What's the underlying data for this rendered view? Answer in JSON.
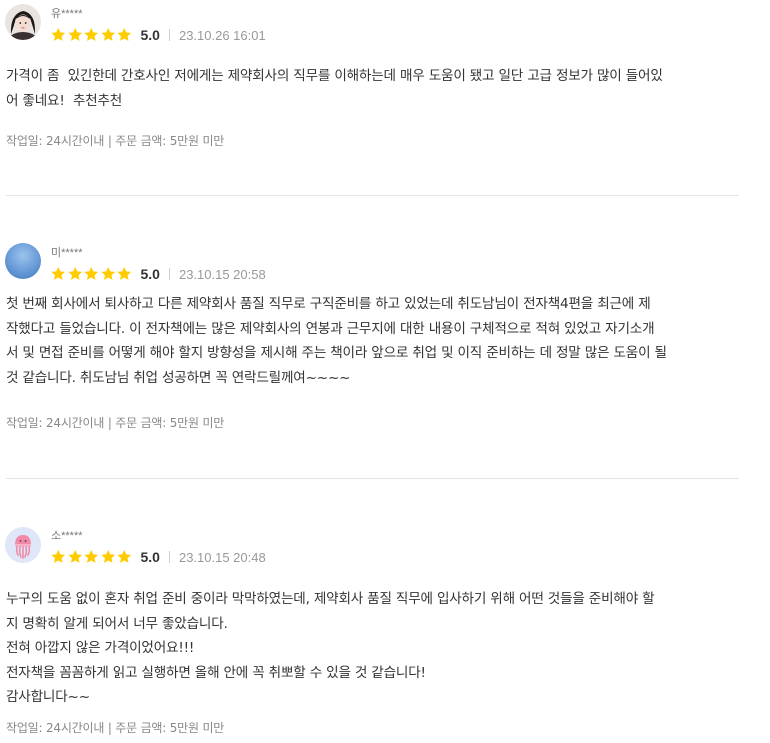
{
  "colors": {
    "star": "#ffcc00",
    "divider": "#e4e4e4",
    "meta_text": "#888888"
  },
  "reviews": [
    {
      "avatar_icon": "user-photo-avatar",
      "user": "유*****",
      "stars": 5,
      "score": "5.0",
      "date": "23.10.26 16:01",
      "body": "가격이 좀  있긴한데 간호사인 저에게는 제약회사의 직무를 이해하는데 매우 도움이 됐고 일단 고급 정보가 많이 들어있\n어 좋네요!  추천추천",
      "meta": "작업일: 24시간이내 | 주문 금액: 5만원 미만"
    },
    {
      "avatar_icon": "blue-gradient-avatar",
      "user": "미*****",
      "stars": 5,
      "score": "5.0",
      "date": "23.10.15 20:58",
      "body": "첫 번째 회사에서 퇴사하고 다른 제약회사 품질 직무로 구직준비를 하고 있었는데 취도남님이 전자책4편을 최근에 제\n작했다고 들었습니다. 이 전자책에는 많은 제약회사의 연봉과 근무지에 대한 내용이 구체적으로 적혀 있었고 자기소개\n서 및 면접 준비를 어떻게 해야 할지 방향성을 제시해 주는 책이라 앞으로 취업 및 이직 준비하는 데 정말 많은 도움이 될\n것 같습니다. 취도남님 취업 성공하면 꼭 연락드릴께여~~~~",
      "meta": "작업일: 24시간이내 | 주문 금액: 5만원 미만"
    },
    {
      "avatar_icon": "jellyfish-avatar",
      "user": "소*****",
      "stars": 5,
      "score": "5.0",
      "date": "23.10.15 20:48",
      "body": "누구의 도움 없이 혼자 취업 준비 중이라 막막하였는데, 제약회사 품질 직무에 입사하기 위해 어떤 것들을 준비해야 할\n지 명확히 알게 되어서 너무 좋았습니다.\n전혀 아깝지 않은 가격이었어요!!!\n전자책을 꼼꼼하게 읽고 실행하면 올해 안에 꼭 취뽀할 수 있을 것 같습니다!\n감사합니다~~",
      "meta": "작업일: 24시간이내 | 주문 금액: 5만원 미만"
    }
  ]
}
